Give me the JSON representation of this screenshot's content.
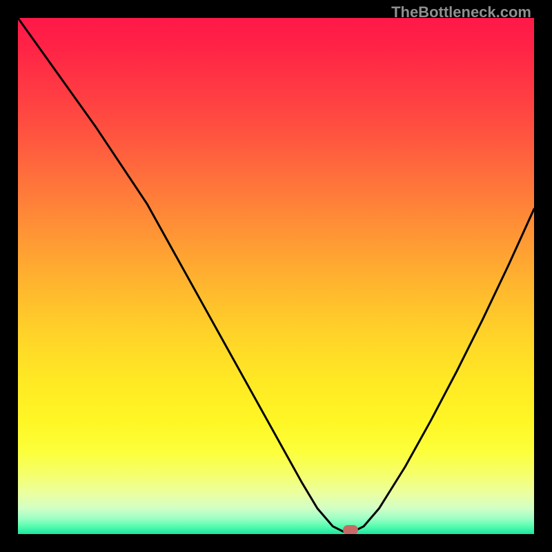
{
  "watermark": "TheBottleneck.com",
  "marker": {
    "color": "#c76a66",
    "x_pct": 64.5,
    "y_pct": 99.2
  },
  "gradient": {
    "stops": [
      {
        "offset": 0.0,
        "color": "#ff1848"
      },
      {
        "offset": 0.06,
        "color": "#ff2446"
      },
      {
        "offset": 0.14,
        "color": "#ff3a43"
      },
      {
        "offset": 0.22,
        "color": "#ff5240"
      },
      {
        "offset": 0.3,
        "color": "#ff6d3c"
      },
      {
        "offset": 0.38,
        "color": "#ff8837"
      },
      {
        "offset": 0.46,
        "color": "#ffa332"
      },
      {
        "offset": 0.54,
        "color": "#ffbd2d"
      },
      {
        "offset": 0.62,
        "color": "#ffd528"
      },
      {
        "offset": 0.7,
        "color": "#ffe824"
      },
      {
        "offset": 0.78,
        "color": "#fff625"
      },
      {
        "offset": 0.84,
        "color": "#fcff3a"
      },
      {
        "offset": 0.88,
        "color": "#f6ff66"
      },
      {
        "offset": 0.92,
        "color": "#ecff9e"
      },
      {
        "offset": 0.95,
        "color": "#d2ffc6"
      },
      {
        "offset": 0.97,
        "color": "#9bffc5"
      },
      {
        "offset": 0.985,
        "color": "#55fdae"
      },
      {
        "offset": 1.0,
        "color": "#1de6a0"
      }
    ]
  },
  "chart_data": {
    "type": "line",
    "title": "",
    "xlabel": "",
    "ylabel": "",
    "xlim": [
      0,
      100
    ],
    "ylim": [
      0,
      100
    ],
    "series": [
      {
        "name": "bottleneck-curve",
        "x": [
          0,
          5,
          10,
          15,
          20,
          25,
          30,
          35,
          40,
          45,
          50,
          55,
          58,
          61,
          63,
          65,
          67,
          70,
          75,
          80,
          85,
          90,
          95,
          100
        ],
        "y": [
          100,
          93,
          86,
          79,
          71.5,
          64,
          55,
          46,
          37,
          28,
          19,
          10,
          5,
          1.5,
          0.5,
          0.5,
          1.5,
          5,
          13,
          22,
          31.5,
          41.5,
          52,
          63
        ]
      }
    ],
    "annotations": [
      {
        "type": "marker",
        "x": 64.5,
        "y": 0.8,
        "label": "optimal-point"
      }
    ]
  }
}
